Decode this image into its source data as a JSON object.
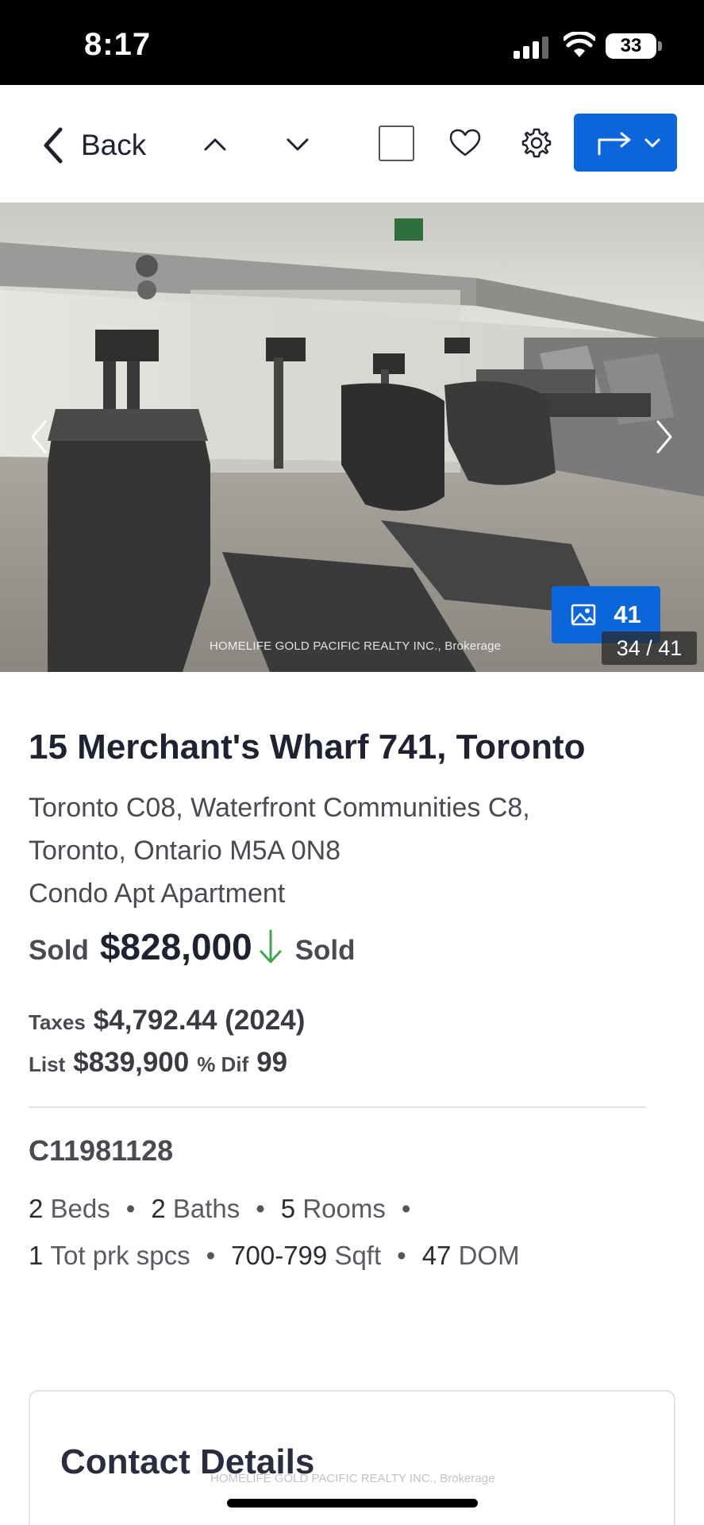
{
  "status_bar": {
    "time": "8:17",
    "battery": "33"
  },
  "toolbar": {
    "back_label": "Back",
    "icons": [
      "chevron-left-icon",
      "chevron-up-icon",
      "chevron-down-icon",
      "checkbox",
      "heart-icon",
      "gear-icon",
      "share-arrow-icon"
    ]
  },
  "photo": {
    "watermark": "HOMELIFE GOLD PACIFIC REALTY INC., Brokerage",
    "photo_count": "41",
    "index_label": "34 / 41"
  },
  "listing": {
    "title": "15 Merchant's Wharf 741, Toronto",
    "area_line": "Toronto C08, Waterfront Communities C8,",
    "city_line": "Toronto, Ontario M5A 0N8",
    "type_line": "Condo Apt Apartment",
    "sold_label": "Sold",
    "price": "$828,000",
    "status": "Sold",
    "taxes_label": "Taxes",
    "taxes_value": "$4,792.44 (2024)",
    "list_label": "List",
    "list_value": "$839,900",
    "dif_label": "% Dif",
    "dif_value": "99",
    "mls": "C11981128",
    "beds_num": "2",
    "beds_label": "Beds",
    "baths_num": "2",
    "baths_label": "Baths",
    "rooms_num": "5",
    "rooms_label": "Rooms",
    "parking_num": "1",
    "parking_label": "Tot prk spcs",
    "sqft_num": "700-799",
    "sqft_label": "Sqft",
    "dom_num": "47",
    "dom_label": "DOM",
    "separator": "•"
  },
  "contact": {
    "title": "Contact Details",
    "watermark": "HOMELIFE GOLD PACIFIC REALTY INC., Brokerage"
  },
  "colors": {
    "accent": "#0b66d9",
    "price_drop": "#3aa84a"
  }
}
